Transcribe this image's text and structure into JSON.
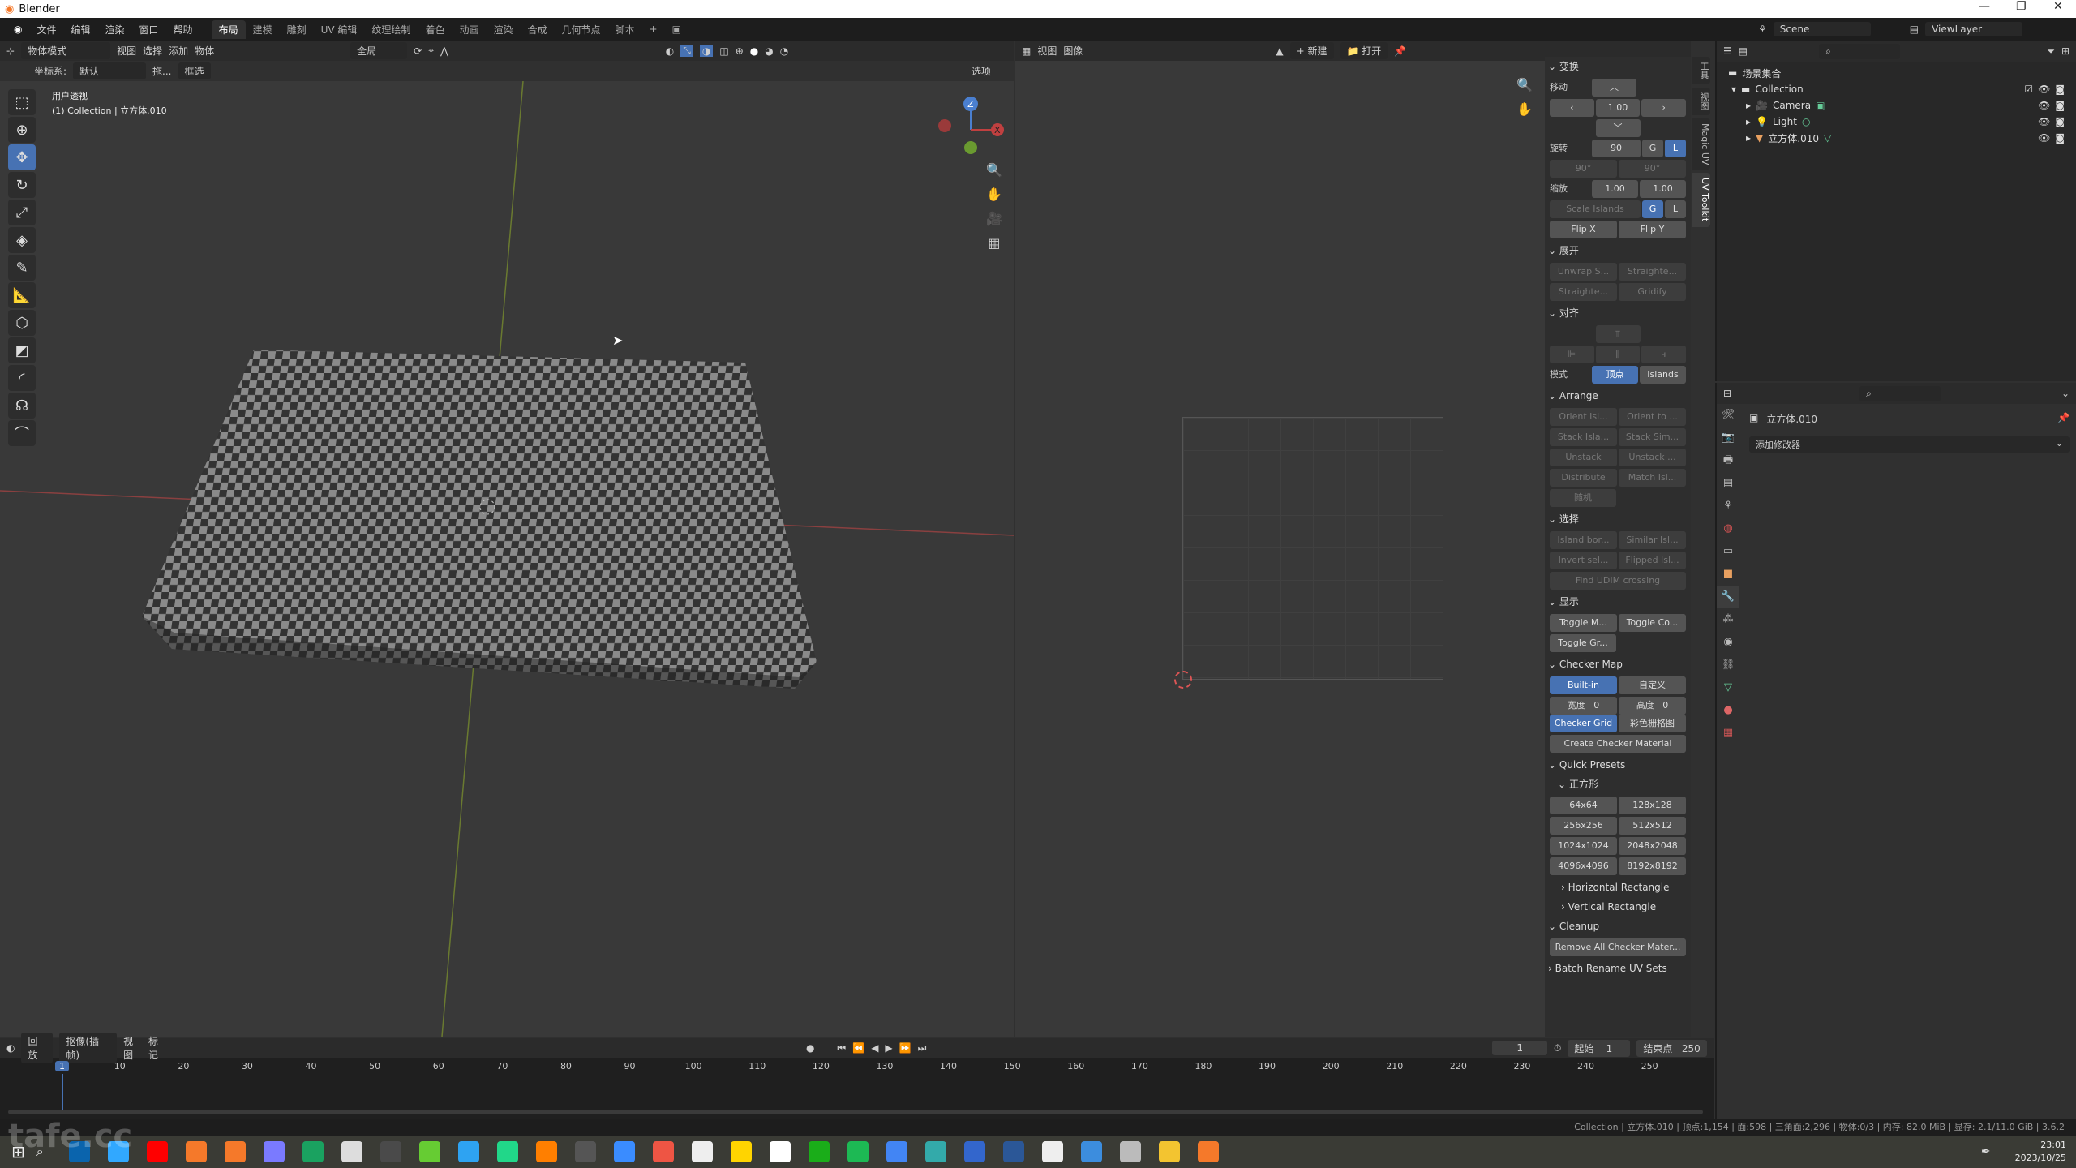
{
  "window": {
    "title": "Blender",
    "controls": [
      "—",
      "❐",
      "✕"
    ]
  },
  "menubar": {
    "menus": [
      "文件",
      "编辑",
      "渲染",
      "窗口",
      "帮助"
    ],
    "workspaces": [
      "布局",
      "建模",
      "雕刻",
      "UV 编辑",
      "纹理绘制",
      "着色",
      "动画",
      "渲染",
      "合成",
      "几何节点",
      "脚本"
    ],
    "active_workspace": 0,
    "add_tab": "+"
  },
  "viewport": {
    "mode": "物体模式",
    "menus": [
      "视图",
      "选择",
      "添加",
      "物体"
    ],
    "orientation": "全局",
    "coord_label": "坐标系:",
    "coord_value": "默认",
    "drag_label": "拖...",
    "select_mode": "框选",
    "options": "选项",
    "view_name": "用户透视",
    "object_info": "(1) Collection | 立方体.010",
    "gizmo_axes": [
      "Z",
      "Y",
      "X"
    ],
    "tools": [
      "select-box",
      "cursor",
      "move",
      "rotate",
      "scale",
      "transform",
      "annotate",
      "measure",
      "add-cube",
      "shear",
      "spin",
      "smooth",
      "edge-slide"
    ],
    "active_tool": 2
  },
  "uv_editor": {
    "menus": [
      "视图",
      "图像"
    ],
    "new_label": "新建",
    "open_label": "打开"
  },
  "npanel": {
    "tabs": [
      "工具",
      "视图",
      "Magic UV",
      "UV Toolkit"
    ],
    "active_tab": 3,
    "transform": {
      "title": "变换",
      "move_label": "移动",
      "move_value": "1.00",
      "rotate_label": "旋转",
      "rotate_value": "90",
      "g": "G",
      "l": "L",
      "rot_ccw": "90°",
      "rot_cw": "90°",
      "scale_label": "缩放",
      "scale_x": "1.00",
      "scale_y": "1.00",
      "scale_islands": "Scale Islands",
      "flip_x": "Flip X",
      "flip_y": "Flip Y"
    },
    "unwrap": {
      "title": "展开",
      "buttons": [
        "Unwrap S...",
        "Straighte...",
        "Straighte...",
        "Gridify"
      ]
    },
    "align": {
      "title": "对齐",
      "mode_label": "模式",
      "modes": [
        "顶点",
        "Islands"
      ],
      "active_mode": 0
    },
    "arrange": {
      "title": "Arrange",
      "buttons": [
        "Orient Isl...",
        "Orient to ...",
        "Stack Isla...",
        "Stack Sim...",
        "Unstack",
        "Unstack ...",
        "Distribute",
        "Match Isl...",
        "随机"
      ]
    },
    "select": {
      "title": "选择",
      "buttons": [
        "Island bor...",
        "Similar Isl...",
        "Invert sel...",
        "Flipped Isl...",
        "Find UDIM crossing"
      ]
    },
    "display": {
      "title": "显示",
      "buttons": [
        "Toggle M...",
        "Toggle Co...",
        "Toggle Gr..."
      ]
    },
    "checker": {
      "title": "Checker Map",
      "source": [
        "Built-in",
        "自定义"
      ],
      "width_label": "宽度",
      "width_value": "0",
      "height_label": "高度",
      "height_value": "0",
      "types": [
        "Checker Grid",
        "彩色栅格图"
      ],
      "create": "Create Checker Material"
    },
    "presets": {
      "title": "Quick Presets",
      "square": "正方形",
      "sizes": [
        "64x64",
        "128x128",
        "256x256",
        "512x512",
        "1024x1024",
        "2048x2048",
        "4096x4096",
        "8192x8192"
      ],
      "horizontal": "Horizontal Rectangle",
      "vertical": "Vertical Rectangle"
    },
    "cleanup": {
      "title": "Cleanup",
      "remove": "Remove All Checker Mater..."
    },
    "batch": "Batch Rename UV Sets"
  },
  "scene": {
    "scene": "Scene",
    "view_layer": "ViewLayer"
  },
  "outliner": {
    "root": "场景集合",
    "items": [
      {
        "name": "Collection",
        "level": 0
      },
      {
        "name": "Camera",
        "level": 1
      },
      {
        "name": "Light",
        "level": 1
      },
      {
        "name": "立方体.010",
        "level": 1
      }
    ]
  },
  "properties": {
    "object": "立方体.010",
    "add_modifier": "添加修改器"
  },
  "timeline": {
    "menus": [
      "回放",
      "抠像(插帧)",
      "视图",
      "标记"
    ],
    "current_frame": "1",
    "start_label": "起始",
    "start": "1",
    "end_label": "结束点",
    "end": "250",
    "ticks": [
      "10",
      "20",
      "30",
      "40",
      "50",
      "60",
      "70",
      "80",
      "90",
      "100",
      "110",
      "120",
      "130",
      "140",
      "150",
      "160",
      "170",
      "180",
      "190",
      "200",
      "210",
      "220",
      "230",
      "240",
      "250"
    ]
  },
  "statusbar": "Collection | 立方体.010 | 顶点:1,154 | 面:598 | 三角面:2,296 | 物体:0/3 | 内存: 82.0 MiB | 显存: 2.1/11.0 GiB | 3.6.2",
  "taskbar": {
    "time": "23:01",
    "date": "2023/10/25",
    "watermark": "tafe.cc",
    "apps": [
      "#0a64ad",
      "#31a8ff",
      "#ff0000",
      "#f5792a",
      "#f5792a",
      "#7a7aff",
      "#1aa260",
      "#ddd",
      "#4a4a4a",
      "#66cc33",
      "#2ea3f2",
      "#21d789",
      "#ff7f00",
      "#555",
      "#3a8cff",
      "#e54",
      "#eee",
      "#ffd400",
      "#fff",
      "#1aad19",
      "#1db954",
      "#4285f4",
      "#3aa",
      "#36c",
      "#2b5797",
      "#eee",
      "#3c8dde",
      "#bbb",
      "#f3c430",
      "#f5792a"
    ]
  },
  "colors": {
    "accent": "#4772b3",
    "header": "#2b2b2b",
    "bg": "#303030"
  }
}
